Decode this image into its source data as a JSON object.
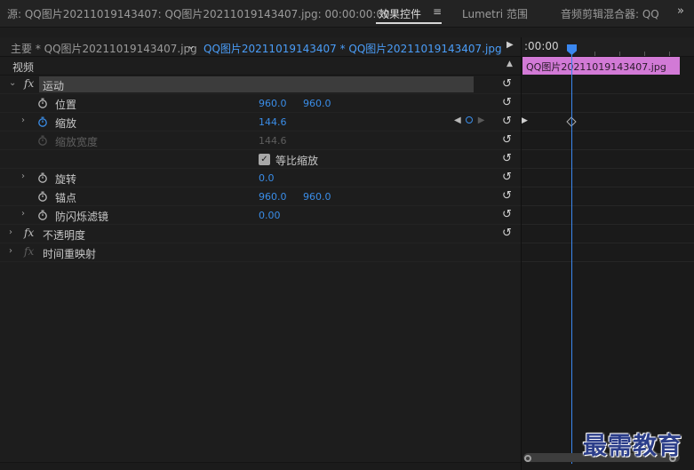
{
  "tabs": {
    "source": "源: QQ图片20211019143407: QQ图片20211019143407.jpg: 00:00:00:00",
    "effects": "效果控件",
    "menu_icon": "≡",
    "lumetri": "Lumetri 范围",
    "audio": "音频剪辑混合器: QQ",
    "overflow": "»"
  },
  "subheader": {
    "master_clip": "主要 * QQ图片20211019143407.jpg",
    "sequence_clip": "QQ图片20211019143407 * QQ图片20211019143407.jpg"
  },
  "timeline": {
    "time": ":00:00",
    "clip_label": "QQ图片20211019143407.jpg"
  },
  "video_header": "视频",
  "effects": {
    "motion": {
      "name": "运动",
      "position": {
        "label": "位置",
        "x": "960.0",
        "y": "960.0"
      },
      "scale": {
        "label": "缩放",
        "value": "144.6"
      },
      "scale_width": {
        "label": "缩放宽度",
        "value": "144.6"
      },
      "uniform_scale": {
        "label": "等比缩放",
        "checked": true
      },
      "rotation": {
        "label": "旋转",
        "value": "0.0"
      },
      "anchor": {
        "label": "锚点",
        "x": "960.0",
        "y": "960.0"
      },
      "antiflicker": {
        "label": "防闪烁滤镜",
        "value": "0.00"
      }
    },
    "opacity": {
      "name": "不透明度"
    },
    "time_remap": {
      "name": "时间重映射"
    }
  },
  "watermark": "最需教育"
}
